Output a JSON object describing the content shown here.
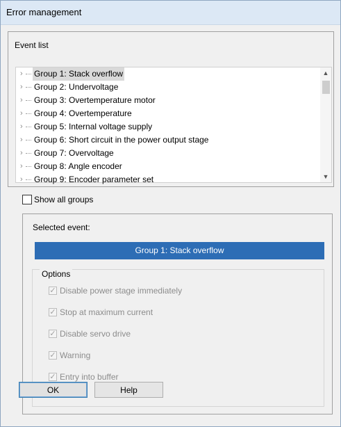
{
  "window": {
    "title": "Error management"
  },
  "event_list": {
    "header": "Event list",
    "items": [
      "Group 1: Stack overflow",
      "Group 2: Undervoltage",
      "Group 3: Overtemperature motor",
      "Group 4: Overtemperature",
      "Group 5: Internal voltage supply",
      "Group 6: Short circuit in the power output stage",
      "Group 7: Overvoltage",
      "Group 8: Angle encoder",
      "Group 9: Encoder parameter set"
    ],
    "selected_index": 0
  },
  "show_all_groups": {
    "label": "Show all groups",
    "checked": false
  },
  "selected_event": {
    "label": "Selected event:",
    "value": "Group 1: Stack overflow"
  },
  "options": {
    "title": "Options",
    "items": [
      {
        "label": "Disable power stage immediately",
        "checked": true
      },
      {
        "label": "Stop at maximum current",
        "checked": true
      },
      {
        "label": "Disable servo drive",
        "checked": true
      },
      {
        "label": "Warning",
        "checked": true
      },
      {
        "label": "Entry into buffer",
        "checked": true
      }
    ]
  },
  "buttons": {
    "ok": "OK",
    "help": "Help"
  },
  "colors": {
    "selection_bar": "#2d6db5",
    "disabled_text": "#8c8c8c"
  }
}
